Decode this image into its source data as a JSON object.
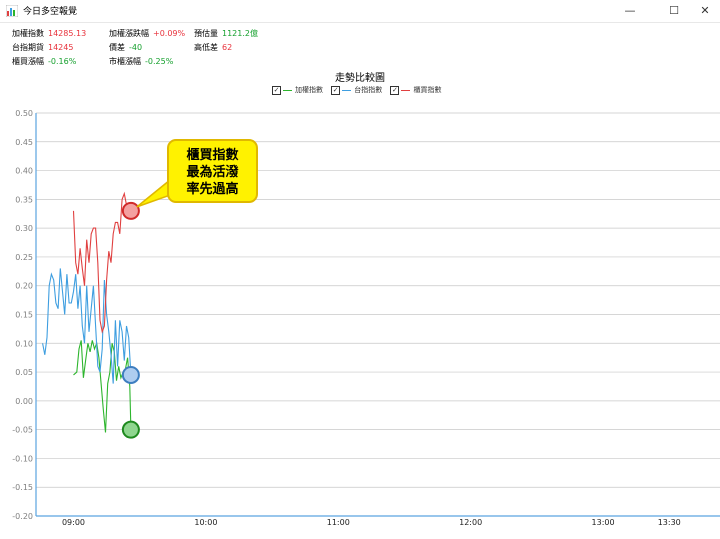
{
  "window": {
    "title": "今日多空報覺",
    "minimize": "—",
    "maximize": "☐",
    "close": "✕"
  },
  "stats": [
    {
      "label": "加權指數",
      "value": "14285.13",
      "color": "red"
    },
    {
      "label": "加權漲跌幅",
      "value": "+0.09%",
      "color": "red"
    },
    {
      "label": "預估量",
      "value": "1121.2億",
      "color": "green"
    },
    {
      "label": "台指期貨",
      "value": "14245",
      "color": "red"
    },
    {
      "label": "價差",
      "value": "-40",
      "color": "green"
    },
    {
      "label": "高低差",
      "value": "62",
      "color": "red"
    },
    {
      "label": "櫃買漲幅",
      "value": "-0.16%",
      "color": "green"
    },
    {
      "label": "市櫃漲幅",
      "value": "-0.25%",
      "color": "green"
    }
  ],
  "callout": {
    "lines": [
      "櫃買指數",
      "最為活潑",
      "率先過高"
    ]
  },
  "colors": {
    "twse": "#2db52d",
    "taifex": "#3e9ee0",
    "otc": "#e04040",
    "axis": "#5ba3e0",
    "grid": "#c8c8c8",
    "tick": "#7f7f7f"
  },
  "chart_data": {
    "type": "line",
    "title": "走勢比較圖",
    "ylim": [
      -0.2,
      0.5
    ],
    "y_ticks": [
      "0.50",
      "0.45",
      "0.40",
      "0.35",
      "0.30",
      "0.25",
      "0.20",
      "0.15",
      "0.10",
      "0.05",
      "0.00",
      "-0.05",
      "-0.10",
      "-0.15",
      "-0.20"
    ],
    "x_ticks": [
      "09:00",
      "10:00",
      "11:00",
      "12:00",
      "13:00",
      "13:30"
    ],
    "x_tick_minutes": [
      0,
      60,
      120,
      180,
      240,
      270
    ],
    "x_range_minutes": [
      -17,
      293
    ],
    "grid": true,
    "legend": "top-center",
    "series": [
      {
        "name": "加權指數",
        "color_key": "twse",
        "x": [
          0,
          1.5,
          2.5,
          3.5,
          4.5,
          5.5,
          6.5,
          7.5,
          8.5,
          9.5,
          10.5,
          11.5,
          12.5,
          13.5,
          14.5,
          15.5,
          16.5,
          17.5,
          18.5,
          19.5,
          20.5,
          21.5,
          22.5,
          23.5,
          24.5,
          25.5,
          26
        ],
        "y": [
          0.045,
          0.05,
          0.09,
          0.105,
          0.04,
          0.07,
          0.1,
          0.085,
          0.105,
          0.09,
          0.1,
          0.075,
          0.03,
          -0.015,
          -0.055,
          0.03,
          0.05,
          0.1,
          0.085,
          0.035,
          0.06,
          0.04,
          0.05,
          0.055,
          0.075,
          0.025,
          -0.05
        ]
      },
      {
        "name": "台指指數",
        "color_key": "taifex",
        "x": [
          -14,
          -13,
          -12,
          -11,
          -10,
          -9,
          -8,
          -7,
          -6,
          -5,
          -4,
          -3,
          -2,
          -1,
          0,
          1,
          2,
          3,
          4,
          5,
          6,
          7,
          8,
          9,
          10,
          11,
          12,
          13,
          14,
          15,
          16,
          17,
          18,
          19,
          20,
          21,
          22,
          23,
          24,
          25,
          26
        ],
        "y": [
          0.1,
          0.08,
          0.11,
          0.2,
          0.22,
          0.21,
          0.17,
          0.16,
          0.23,
          0.19,
          0.15,
          0.22,
          0.17,
          0.17,
          0.19,
          0.22,
          0.16,
          0.2,
          0.13,
          0.1,
          0.2,
          0.12,
          0.16,
          0.2,
          0.13,
          0.06,
          0.05,
          0.09,
          0.21,
          0.15,
          0.12,
          0.08,
          0.03,
          0.14,
          0.06,
          0.14,
          0.12,
          0.07,
          0.13,
          0.11,
          0.045
        ]
      },
      {
        "name": "櫃買指數",
        "color_key": "otc",
        "x": [
          0,
          1,
          2,
          3,
          4,
          5,
          6,
          7,
          8,
          9,
          10,
          11,
          12,
          13,
          14,
          15,
          16,
          17,
          18,
          19,
          20,
          21,
          22,
          23,
          24,
          25,
          26
        ],
        "y": [
          0.33,
          0.24,
          0.22,
          0.265,
          0.23,
          0.2,
          0.28,
          0.24,
          0.29,
          0.3,
          0.3,
          0.24,
          0.14,
          0.12,
          0.13,
          0.21,
          0.26,
          0.24,
          0.29,
          0.31,
          0.31,
          0.29,
          0.35,
          0.36,
          0.34,
          0.335,
          0.33
        ]
      }
    ],
    "end_markers": [
      {
        "series": "櫃買指數",
        "x": 26,
        "y": 0.33
      },
      {
        "series": "台指指數",
        "x": 26,
        "y": 0.045
      },
      {
        "series": "加權指數",
        "x": 26,
        "y": -0.05
      }
    ]
  }
}
